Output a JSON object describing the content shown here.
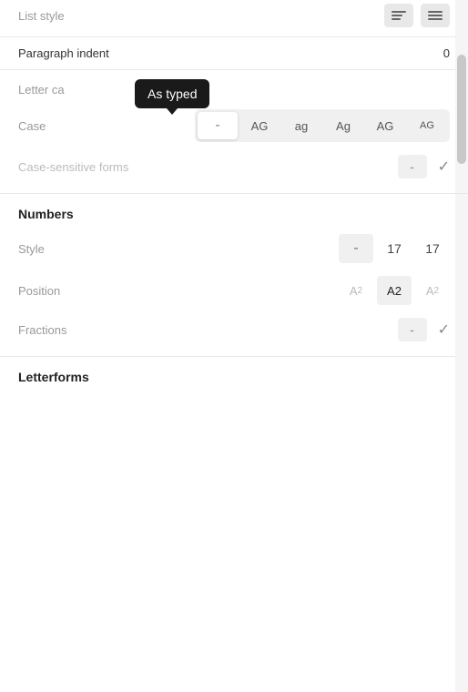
{
  "top": {
    "list_style_label": "List style",
    "paragraph_indent_label": "Paragraph indent",
    "paragraph_indent_value": "0"
  },
  "letter_case": {
    "section_label": "Letter ca",
    "tooltip_text": "As typed",
    "case_label": "Case",
    "case_options": [
      {
        "label": "-",
        "type": "dash"
      },
      {
        "label": "AG",
        "type": "all-caps"
      },
      {
        "label": "ag",
        "type": "lower"
      },
      {
        "label": "Ag",
        "type": "title"
      },
      {
        "label": "AG",
        "type": "upper"
      },
      {
        "label": "AG",
        "type": "small-caps"
      }
    ],
    "active_case_index": 0,
    "sensitive_label": "Case-sensitive forms",
    "sensitive_dash": "-",
    "sensitive_check": "✓"
  },
  "numbers": {
    "section_label": "Numbers",
    "style_label": "Style",
    "style_options": [
      {
        "label": "-",
        "type": "dash"
      },
      {
        "label": "17",
        "type": "normal"
      },
      {
        "label": "17",
        "type": "oldstyle"
      }
    ],
    "active_style_index": 0,
    "position_label": "Position",
    "position_options": [
      {
        "label": "A₂",
        "type": "sub"
      },
      {
        "label": "A2",
        "type": "normal"
      },
      {
        "label": "A²",
        "type": "super"
      }
    ],
    "active_position_index": 1,
    "fractions_label": "Fractions",
    "fractions_dash": "-",
    "fractions_check": "✓"
  },
  "letterforms": {
    "section_label": "Letterforms"
  }
}
